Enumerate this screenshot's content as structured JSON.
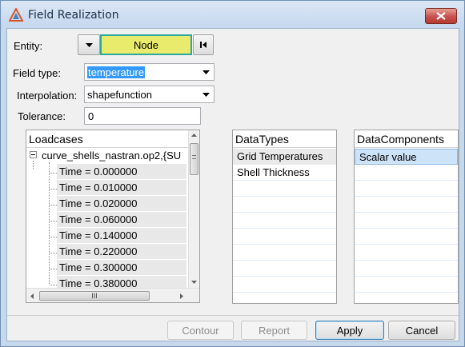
{
  "window": {
    "title": "Field Realization",
    "close_icon": "close-icon"
  },
  "entity": {
    "label": "Entity:",
    "value": "Node",
    "value_bg": "#e8eb6c",
    "value_border": "#2ea79d"
  },
  "field_type": {
    "label": "Field type:",
    "value": "temperature"
  },
  "interpolation": {
    "label": "Interpolation:",
    "value": "shapefunction"
  },
  "tolerance": {
    "label": "Tolerance:",
    "value": "0"
  },
  "loadcases": {
    "header": "Loadcases",
    "root": "curve_shells_nastran.op2,{SU",
    "items": [
      "Time = 0.000000",
      "Time = 0.010000",
      "Time = 0.020000",
      "Time = 0.060000",
      "Time = 0.140000",
      "Time = 0.220000",
      "Time = 0.300000",
      "Time = 0.380000"
    ],
    "hscroll_thumb": "III"
  },
  "datatypes": {
    "header": "DataTypes",
    "items": [
      "Grid Temperatures",
      "Shell Thickness"
    ],
    "selected_index": 0
  },
  "datacomponents": {
    "header": "DataComponents",
    "items": [
      "Scalar value"
    ],
    "selected_index": 0
  },
  "buttons": {
    "contour": "Contour",
    "report": "Report",
    "apply": "Apply",
    "cancel": "Cancel"
  },
  "colors": {
    "title_bg": "#c4d7ee",
    "selection": "#3399ff",
    "list_selected": "#cde3f7"
  }
}
